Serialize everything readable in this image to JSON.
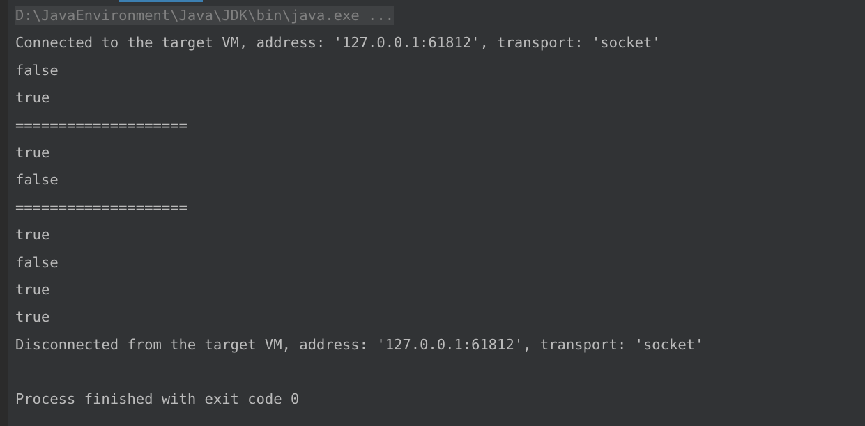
{
  "console": {
    "title": "Run console output",
    "top_indicator_color": "#3c7fb1",
    "background_color": "#313335",
    "gutter_color": "#2b2b2b",
    "text_color": "#bbbbbb",
    "command_text_color": "#808080",
    "command_highlight_color": "#3f4143",
    "lines": [
      {
        "text": "D:\\JavaEnvironment\\Java\\JDK\\bin\\java.exe ...",
        "kind": "command"
      },
      {
        "text": "Connected to the target VM, address: '127.0.0.1:61812', transport: 'socket'",
        "kind": "output"
      },
      {
        "text": "false",
        "kind": "output"
      },
      {
        "text": "true",
        "kind": "output"
      },
      {
        "text": "====================",
        "kind": "output"
      },
      {
        "text": "true",
        "kind": "output"
      },
      {
        "text": "false",
        "kind": "output"
      },
      {
        "text": "====================",
        "kind": "output"
      },
      {
        "text": "true",
        "kind": "output"
      },
      {
        "text": "false",
        "kind": "output"
      },
      {
        "text": "true",
        "kind": "output"
      },
      {
        "text": "true",
        "kind": "output"
      },
      {
        "text": "Disconnected from the target VM, address: '127.0.0.1:61812', transport: 'socket'",
        "kind": "output"
      },
      {
        "text": "",
        "kind": "blank"
      },
      {
        "text": "Process finished with exit code 0",
        "kind": "output"
      }
    ]
  }
}
